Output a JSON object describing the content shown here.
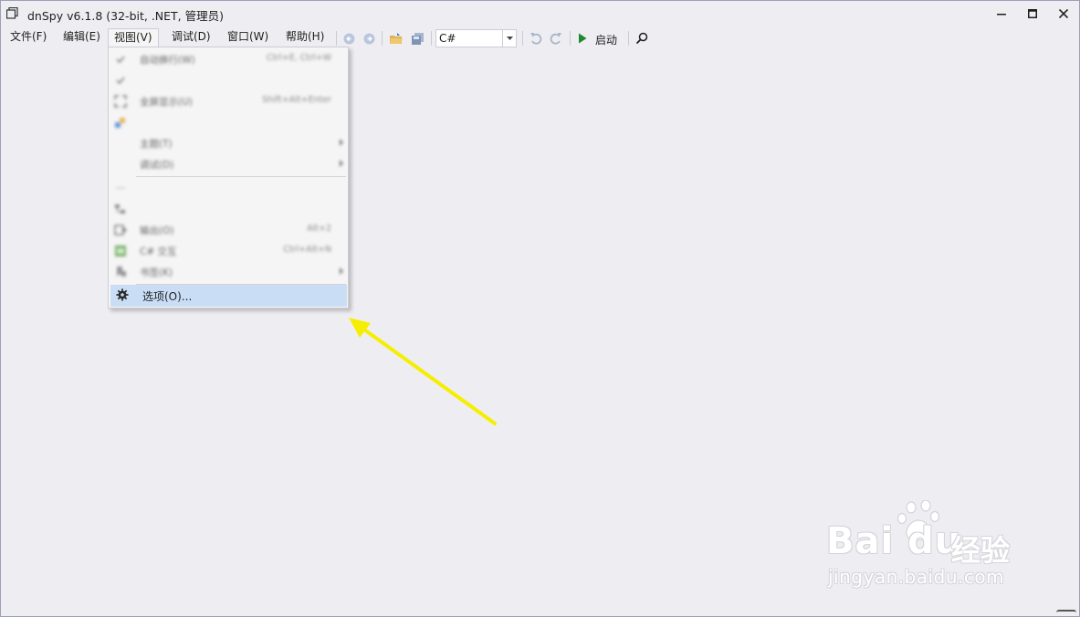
{
  "window": {
    "title": "dnSpy v6.1.8 (32-bit, .NET, 管理员)"
  },
  "menubar": {
    "items": [
      {
        "label": "文件(F)"
      },
      {
        "label": "编辑(E)"
      },
      {
        "label": "视图(V)"
      },
      {
        "label": "调试(D)"
      },
      {
        "label": "窗口(W)"
      },
      {
        "label": "帮助(H)"
      }
    ]
  },
  "toolbar": {
    "language_value": "C#",
    "start_label": "启动"
  },
  "view_menu": {
    "items": [
      {
        "label": "自动换行(W)",
        "shortcut": "Ctrl+E, Ctrl+W",
        "icon": "check-icon"
      },
      {
        "label": "全屏显示(U)",
        "shortcut": "Shift+Alt+Enter",
        "icon": "fullscreen-icon"
      },
      {
        "label": "主题(T)",
        "icon": "none"
      },
      {
        "label": "调试(D)",
        "icon": "none"
      },
      {
        "label": "输出(O)",
        "shortcut": "Alt+2",
        "icon": "output-icon"
      },
      {
        "label": "C# 交互",
        "shortcut": "Ctrl+Alt+N",
        "icon": "csharp-interactive-icon"
      },
      {
        "label": "书签(K)",
        "icon": "bookmark-icon"
      },
      {
        "label": "选项(O)...",
        "icon": "gear-icon"
      }
    ]
  },
  "watermark": {
    "brand": "Bai du",
    "cn": "经验",
    "url": "jingyan.baidu.com"
  },
  "colors": {
    "background": "#eeeef2",
    "menu_background": "#f5f5f5",
    "menu_highlight": "#c9def5",
    "annotation_arrow": "#f5ee00",
    "run_green": "#1e8a2e"
  }
}
